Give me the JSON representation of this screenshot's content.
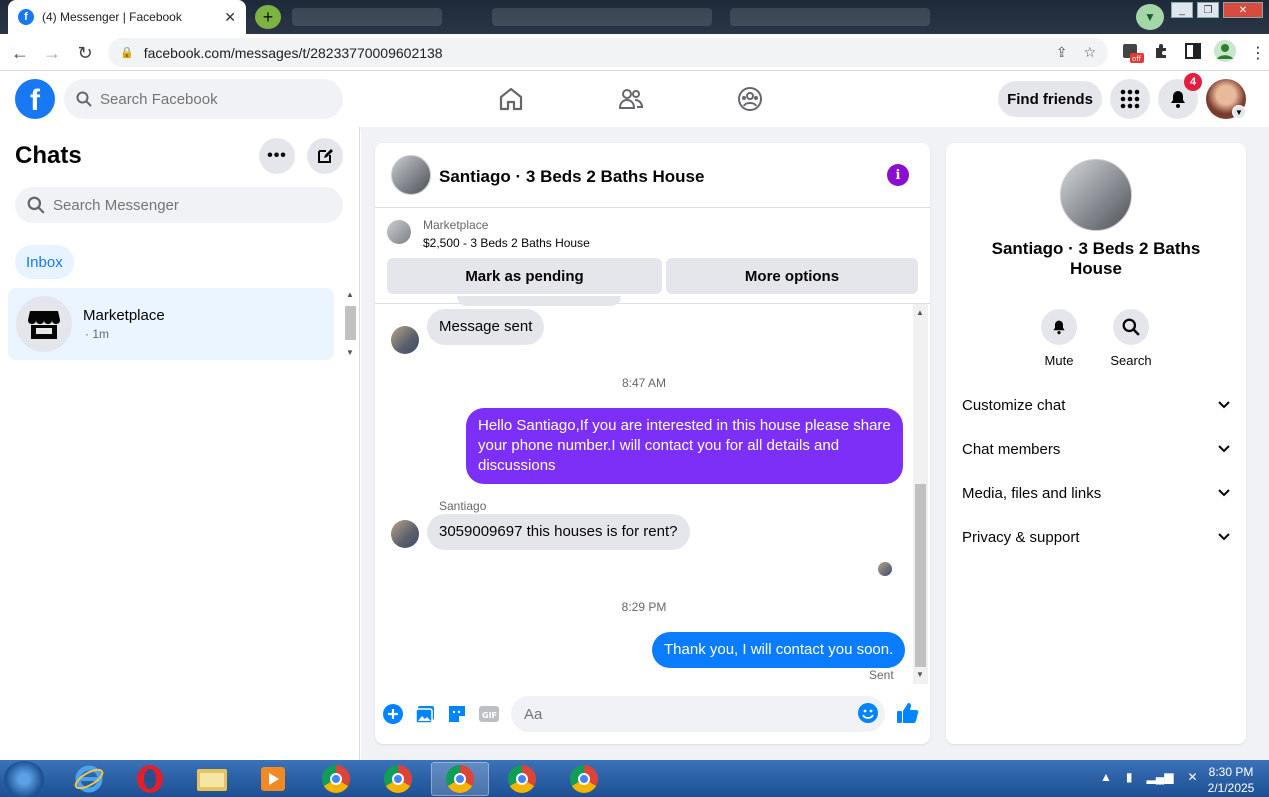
{
  "browser": {
    "tab_title": "(4) Messenger | Facebook",
    "url": "facebook.com/messages/t/28233770009602138",
    "ext_badge": "off"
  },
  "fb_header": {
    "search_placeholder": "Search Facebook",
    "find_friends": "Find friends",
    "notification_count": "4",
    "logo_letter": "f"
  },
  "sidebar": {
    "title": "Chats",
    "search_placeholder": "Search Messenger",
    "inbox_label": "Inbox",
    "chats": [
      {
        "name": "Marketplace",
        "time": "· 1m"
      }
    ]
  },
  "conversation": {
    "title": "Santiago · 3 Beds 2 Baths House",
    "info_glyph": "i",
    "marketplace": {
      "label": "Marketplace",
      "listing": "$2,500 - 3 Beds 2 Baths House",
      "pending_button": "Mark as pending",
      "more_button": "More options"
    },
    "messages": {
      "m1_text": "Message sent",
      "stamp1": "8:47 AM",
      "m2_text": "Hello Santiago,If you are interested in this house please share your phone number.I will contact you for all details and discussions",
      "m3_sender": "Santiago",
      "m3_text": "3059009697 this houses is for rent?",
      "stamp2": "8:29 PM",
      "m4_text": "Thank you, I will contact you soon.",
      "m4_status": "Sent"
    },
    "composer_placeholder": "Aa"
  },
  "details": {
    "name": "Santiago · 3 Beds 2 Baths House",
    "actions": [
      {
        "label": "Mute",
        "icon": "bell-icon"
      },
      {
        "label": "Search",
        "icon": "search-icon"
      }
    ],
    "sections": [
      "Customize chat",
      "Chat members",
      "Media, files and links",
      "Privacy & support"
    ]
  },
  "taskbar": {
    "time": "8:30 PM",
    "date": "2/1/2025"
  },
  "colors": {
    "facebook_blue": "#1877f2",
    "outgoing_purple": "#7b2ff7",
    "outgoing_blue": "#0a7cff",
    "info_purple": "#8a0fd1",
    "notification_red": "#e41e3f"
  }
}
